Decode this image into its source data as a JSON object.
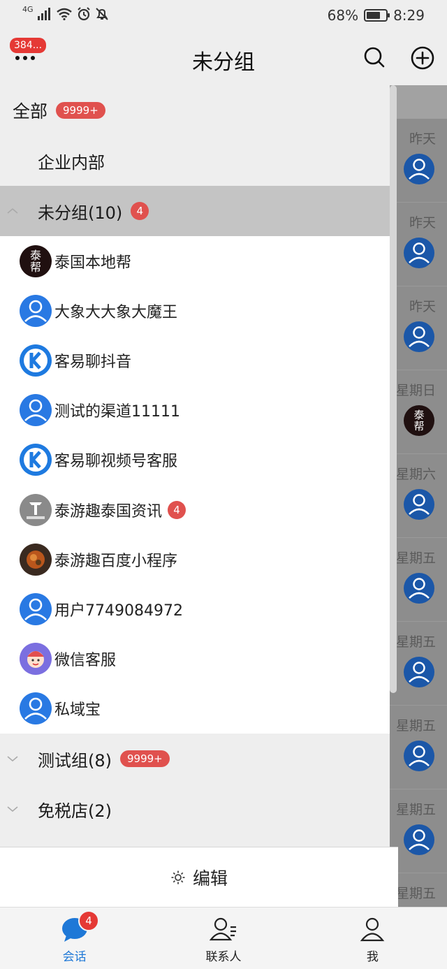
{
  "status_bar": {
    "network": "4G",
    "battery": "68%",
    "time": "8:29"
  },
  "header": {
    "title": "未分组",
    "unread_count": "384..."
  },
  "groups": {
    "all": {
      "label": "全部",
      "badge": "9999+"
    },
    "enterprise": {
      "label": "企业内部"
    },
    "ungrouped": {
      "label": "未分组(10)",
      "badge": "4"
    },
    "test": {
      "label": "测试组(8)",
      "badge": "9999+"
    },
    "dutyfree": {
      "label": "免税店(2)"
    }
  },
  "members": [
    {
      "name": "泰国本地帮",
      "avatar": "thai-bang-logo"
    },
    {
      "name": "大象大大象大魔王",
      "avatar": "default-user-icon"
    },
    {
      "name": "客易聊抖音",
      "avatar": "k-logo"
    },
    {
      "name": "测试的渠道11111",
      "avatar": "default-user-icon"
    },
    {
      "name": "客易聊视频号客服",
      "avatar": "k-logo"
    },
    {
      "name": "泰游趣泰国资讯",
      "avatar": "taiyouqu-logo",
      "badge": "4"
    },
    {
      "name": "泰游趣百度小程序",
      "avatar": "photo-avatar"
    },
    {
      "name": "用户7749084972",
      "avatar": "default-user-icon"
    },
    {
      "name": "微信客服",
      "avatar": "cartoon-avatar"
    },
    {
      "name": "私域宝",
      "avatar": "default-user-icon"
    }
  ],
  "background_list": {
    "times": [
      "昨天",
      "昨天",
      "昨天",
      "星期日",
      "星期六",
      "星期五",
      "星期五",
      "星期五",
      "星期五",
      "星期五"
    ]
  },
  "edit": {
    "label": "编辑"
  },
  "tabs": [
    {
      "label": "会话",
      "badge": "4"
    },
    {
      "label": "联系人"
    },
    {
      "label": "我"
    }
  ],
  "colors": {
    "accent": "#1e78d7",
    "badge": "#e0514e",
    "active_group": "#c4c4c4"
  }
}
